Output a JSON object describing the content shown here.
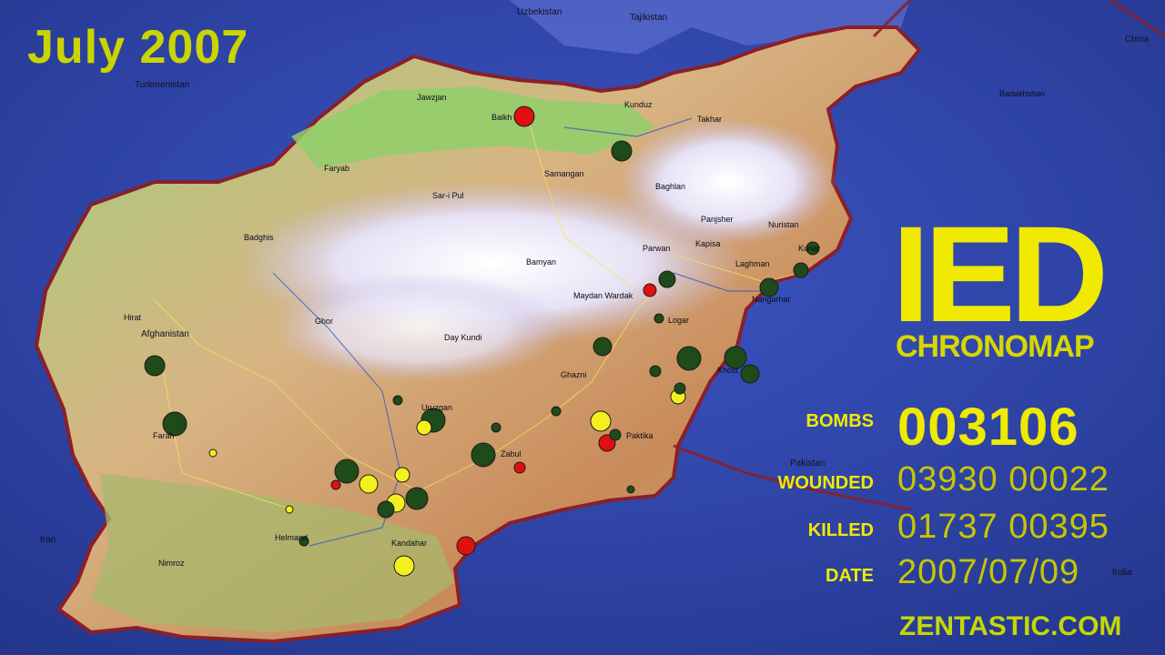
{
  "header": {
    "month": "July 2007"
  },
  "title": {
    "main": "IED",
    "sub": "CHRONOMAP"
  },
  "stats": {
    "bombs_label": "BOMBS",
    "bombs_value": "003106",
    "wounded_label": "WOUNDED",
    "wounded_value": "03930 00022",
    "killed_label": "KILLED",
    "killed_value": "01737 00395",
    "date_label": "DATE",
    "date_value": "2007/07/09"
  },
  "footer": {
    "site": "ZENTASTIC.COM"
  },
  "countries": [
    "Uzbekistan",
    "Tajikistan",
    "Turkmenistan",
    "China",
    "Afghanistan",
    "Pakistan",
    "Iran",
    "India"
  ],
  "provinces": [
    "Jawzjan",
    "Balkh",
    "Kunduz",
    "Takhar",
    "Badakhshan",
    "Faryab",
    "Samangan",
    "Sar-i Pul",
    "Baghlan",
    "Panjsher",
    "Nuristan",
    "Badghis",
    "Parwan",
    "Kapisa",
    "Kunar",
    "Laghman",
    "Bamyan",
    "Maydan Wardak",
    "Nangarhar",
    "Hirat",
    "Ghor",
    "Logar",
    "Day Kundi",
    "Khost",
    "Ghazni",
    "Uruzgan",
    "Farah",
    "Paktika",
    "Zabul",
    "Helmand",
    "Kandahar",
    "Nimroz"
  ],
  "legend": {
    "colors": {
      "red": "#e01010",
      "yellow": "#f4f020",
      "green": "#1f4a1a"
    }
  }
}
